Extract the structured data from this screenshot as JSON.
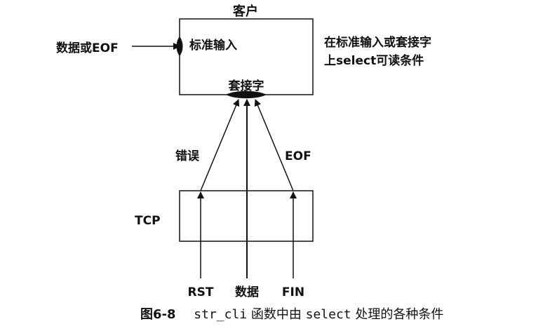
{
  "client": {
    "title": "客户",
    "stdin_label": "标准输入",
    "socket_label": "套接字"
  },
  "input": {
    "label": "数据或EOF"
  },
  "note": {
    "line1": "在标准输入或套接字",
    "line2": "上select可读条件"
  },
  "arrows": {
    "error_label": "错误",
    "eof_label": "EOF"
  },
  "tcp": {
    "label": "TCP"
  },
  "bottom": {
    "rst": "RST",
    "data": "数据",
    "fin": "FIN"
  },
  "caption": {
    "figure_no": "图6-8",
    "text_mono": "str_cli",
    "text_1": "函数中由",
    "text_mono_2": "select",
    "text_2": "处理的各种条件"
  }
}
